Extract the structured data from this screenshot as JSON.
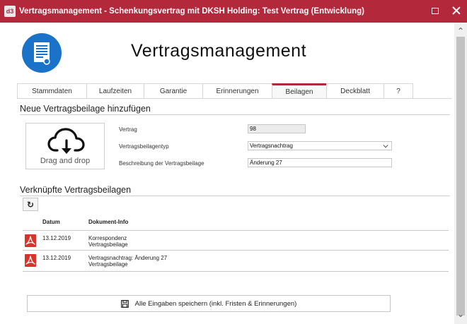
{
  "window": {
    "badge": "d3",
    "title": "Vertragsmanagement - Schenkungsvertrag mit DKSH Holding: Test Vertrag (Entwicklung)"
  },
  "header": {
    "title": "Vertragsmanagement",
    "logo_icon": "contract-document-icon"
  },
  "tabs": [
    {
      "label": "Stammdaten",
      "active": false
    },
    {
      "label": "Laufzeiten",
      "active": false
    },
    {
      "label": "Garantie",
      "active": false
    },
    {
      "label": "Erinnerungen",
      "active": false
    },
    {
      "label": "Beilagen",
      "active": true
    },
    {
      "label": "Deckblatt",
      "active": false
    },
    {
      "label": "?",
      "active": false
    }
  ],
  "add_section": {
    "title": "Neue Vertragsbeilage hinzufügen",
    "dropzone_label": "Drag and drop",
    "fields": {
      "contract_label": "Vertrag",
      "contract_value": "98",
      "type_label": "Vertragsbeilagentyp",
      "type_value": "Vertragsnachtrag",
      "description_label": "Beschreibung der Vertragsbeilage",
      "description_value": "Änderung 27"
    }
  },
  "linked_section": {
    "title": "Verknüpfte Vertragsbeilagen",
    "columns": {
      "date": "Datum",
      "info": "Dokument-Info"
    },
    "rows": [
      {
        "date": "13.12.2019",
        "info_line1": "Korrespondenz",
        "info_line2": "Vertragsbeilage"
      },
      {
        "date": "13.12.2019",
        "info_line1": "Vertragsnachtrag: Änderung 27",
        "info_line2": "Vertragsbeilage"
      }
    ]
  },
  "save_button": {
    "label": "Alle Eingaben speichern (inkl. Fristen & Erinnerungen)"
  },
  "colors": {
    "accent": "#b4283c",
    "logo": "#1a73c9",
    "pdf": "#d9342b"
  }
}
